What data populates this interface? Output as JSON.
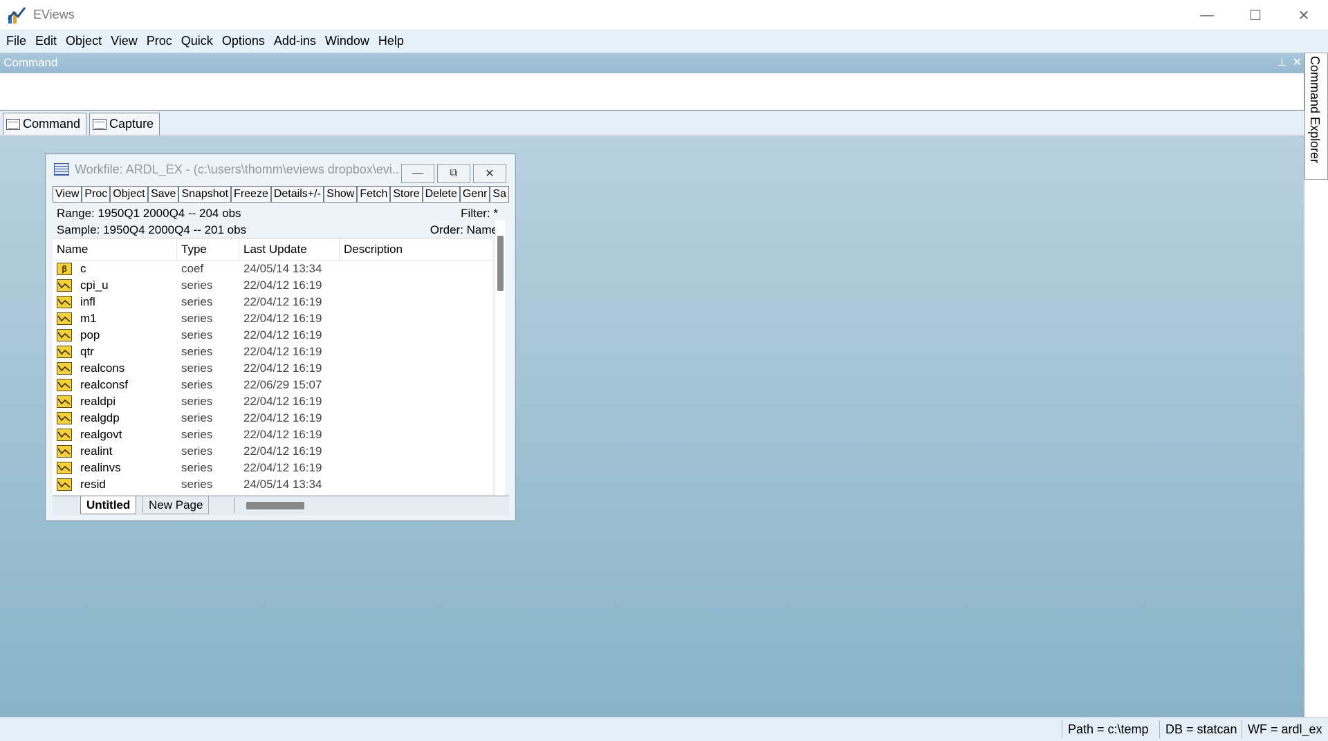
{
  "app": {
    "title": "EViews",
    "accent": "#97b9d0"
  },
  "window_controls": {
    "minimize": "—",
    "maximize": "☐",
    "close": "✕"
  },
  "menu": [
    "File",
    "Edit",
    "Object",
    "View",
    "Proc",
    "Quick",
    "Options",
    "Add-ins",
    "Window",
    "Help"
  ],
  "command": {
    "header": "Command",
    "pin": "⊥",
    "close": "✕",
    "tabs": [
      "Command",
      "Capture"
    ],
    "explorer": "Command Explorer"
  },
  "workfile": {
    "title": "Workfile: ARDL_EX - (c:\\users\\thomm\\eviews dropbox\\evi...",
    "controls": {
      "minimize": "—",
      "restore": "⧉",
      "close": "✕"
    },
    "toolbar": [
      "View",
      "Proc",
      "Object",
      "Save",
      "Snapshot",
      "Freeze",
      "Details+/-",
      "Show",
      "Fetch",
      "Store",
      "Delete",
      "Genr",
      "Sa"
    ],
    "range": "Range:  1950Q1 2000Q4  --  204 obs",
    "filter": "Filter: *",
    "sample": "Sample: 1950Q4 2000Q4  --  201 obs",
    "order": "Order: Name",
    "columns": [
      "Name",
      "Type",
      "Last Update",
      "Description"
    ],
    "rows": [
      {
        "name": "c",
        "type": "coef",
        "date": "24/05/14  13:34",
        "icon": "coef-icon"
      },
      {
        "name": "cpi_u",
        "type": "series",
        "date": "22/04/12  16:19",
        "icon": "series-icon"
      },
      {
        "name": "infl",
        "type": "series",
        "date": "22/04/12  16:19",
        "icon": "series-icon"
      },
      {
        "name": "m1",
        "type": "series",
        "date": "22/04/12  16:19",
        "icon": "series-icon"
      },
      {
        "name": "pop",
        "type": "series",
        "date": "22/04/12  16:19",
        "icon": "series-icon"
      },
      {
        "name": "qtr",
        "type": "series",
        "date": "22/04/12  16:19",
        "icon": "series-icon"
      },
      {
        "name": "realcons",
        "type": "series",
        "date": "22/04/12  16:19",
        "icon": "series-icon"
      },
      {
        "name": "realconsf",
        "type": "series",
        "date": "22/06/29  15:07",
        "icon": "series-icon"
      },
      {
        "name": "realdpi",
        "type": "series",
        "date": "22/04/12  16:19",
        "icon": "series-icon"
      },
      {
        "name": "realgdp",
        "type": "series",
        "date": "22/04/12  16:19",
        "icon": "series-icon"
      },
      {
        "name": "realgovt",
        "type": "series",
        "date": "22/04/12  16:19",
        "icon": "series-icon"
      },
      {
        "name": "realint",
        "type": "series",
        "date": "22/04/12  16:19",
        "icon": "series-icon"
      },
      {
        "name": "realinvs",
        "type": "series",
        "date": "22/04/12  16:19",
        "icon": "series-icon"
      },
      {
        "name": "resid",
        "type": "series",
        "date": "24/05/14  13:34",
        "icon": "series-icon"
      }
    ],
    "pages": [
      "Untitled",
      "New Page"
    ]
  },
  "status": {
    "path": "Path = c:\\temp",
    "db": "DB = statcan",
    "wf": "WF = ardl_ex"
  }
}
